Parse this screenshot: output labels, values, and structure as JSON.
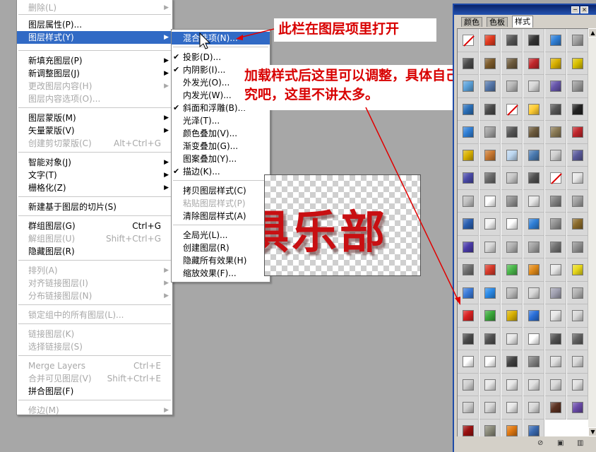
{
  "main_menu": {
    "items": [
      {
        "label": "删除(L)",
        "shortcut": "",
        "submenu": true,
        "disabled": true
      },
      {
        "label": "图层属性(P)...",
        "shortcut": "",
        "submenu": false,
        "disabled": false
      },
      {
        "label": "图层样式(Y)",
        "shortcut": "",
        "submenu": true,
        "disabled": false,
        "highlighted": true
      },
      {
        "label": "新填充图层(P)",
        "shortcut": "",
        "submenu": true,
        "disabled": false
      },
      {
        "label": "新调整图层(J)",
        "shortcut": "",
        "submenu": true,
        "disabled": false
      },
      {
        "label": "更改图层内容(H)",
        "shortcut": "",
        "submenu": true,
        "disabled": true
      },
      {
        "label": "图层内容选项(O)...",
        "shortcut": "",
        "submenu": false,
        "disabled": true
      },
      {
        "label": "图层蒙版(M)",
        "shortcut": "",
        "submenu": true,
        "disabled": false
      },
      {
        "label": "矢量蒙版(V)",
        "shortcut": "",
        "submenu": true,
        "disabled": false
      },
      {
        "label": "创建剪切蒙版(C)",
        "shortcut": "Alt+Ctrl+G",
        "submenu": false,
        "disabled": true
      },
      {
        "label": "智能对象(J)",
        "shortcut": "",
        "submenu": true,
        "disabled": false
      },
      {
        "label": "文字(T)",
        "shortcut": "",
        "submenu": true,
        "disabled": false
      },
      {
        "label": "栅格化(Z)",
        "shortcut": "",
        "submenu": true,
        "disabled": false
      },
      {
        "label": "新建基于图层的切片(S)",
        "shortcut": "",
        "submenu": false,
        "disabled": false
      },
      {
        "label": "群组图层(G)",
        "shortcut": "Ctrl+G",
        "submenu": false,
        "disabled": false
      },
      {
        "label": "解组图层(U)",
        "shortcut": "Shift+Ctrl+G",
        "submenu": false,
        "disabled": true
      },
      {
        "label": "隐藏图层(R)",
        "shortcut": "",
        "submenu": false,
        "disabled": false
      },
      {
        "label": "排列(A)",
        "shortcut": "",
        "submenu": true,
        "disabled": true
      },
      {
        "label": "对齐链接图层(I)",
        "shortcut": "",
        "submenu": true,
        "disabled": true
      },
      {
        "label": "分布链接图层(N)",
        "shortcut": "",
        "submenu": true,
        "disabled": true
      },
      {
        "label": "锁定组中的所有图层(L)...",
        "shortcut": "",
        "submenu": false,
        "disabled": true
      },
      {
        "label": "链接图层(K)",
        "shortcut": "",
        "submenu": false,
        "disabled": true
      },
      {
        "label": "选择链接层(S)",
        "shortcut": "",
        "submenu": false,
        "disabled": true
      },
      {
        "label": "Merge Layers",
        "shortcut": "Ctrl+E",
        "submenu": false,
        "disabled": true
      },
      {
        "label": "合并可见图层(V)",
        "shortcut": "Shift+Ctrl+E",
        "submenu": false,
        "disabled": true
      },
      {
        "label": "拼合图层(F)",
        "shortcut": "",
        "submenu": false,
        "disabled": false
      },
      {
        "label": "修边(M)",
        "shortcut": "",
        "submenu": true,
        "disabled": true
      }
    ]
  },
  "sub_menu": {
    "items": [
      {
        "label": "混合选项(N)...",
        "checked": false,
        "disabled": false,
        "highlighted": true
      },
      {
        "label": "投影(D)...",
        "checked": true,
        "disabled": false
      },
      {
        "label": "内阴影(I)...",
        "checked": true,
        "disabled": false
      },
      {
        "label": "外发光(O)...",
        "checked": false,
        "disabled": false
      },
      {
        "label": "内发光(W)...",
        "checked": false,
        "disabled": false
      },
      {
        "label": "斜面和浮雕(B)...",
        "checked": true,
        "disabled": false
      },
      {
        "label": "光泽(T)...",
        "checked": false,
        "disabled": false
      },
      {
        "label": "颜色叠加(V)...",
        "checked": false,
        "disabled": false
      },
      {
        "label": "渐变叠加(G)...",
        "checked": false,
        "disabled": false
      },
      {
        "label": "图案叠加(Y)...",
        "checked": false,
        "disabled": false
      },
      {
        "label": "描边(K)...",
        "checked": true,
        "disabled": false
      },
      {
        "label": "拷贝图层样式(C)",
        "checked": false,
        "disabled": false
      },
      {
        "label": "粘贴图层样式(P)",
        "checked": false,
        "disabled": true
      },
      {
        "label": "清除图层样式(A)",
        "checked": false,
        "disabled": false
      },
      {
        "label": "全局光(L)...",
        "checked": false,
        "disabled": false
      },
      {
        "label": "创建图层(R)",
        "checked": false,
        "disabled": false
      },
      {
        "label": "隐藏所有效果(H)",
        "checked": false,
        "disabled": false
      },
      {
        "label": "缩放效果(F)...",
        "checked": false,
        "disabled": false
      }
    ]
  },
  "canvas": {
    "text": "俱乐部"
  },
  "callouts": {
    "top": "此栏在图层项里打开",
    "body": "加载样式后这里可以调整，具体自己研究吧，这里不讲太多。"
  },
  "palette": {
    "tabs": [
      "颜色",
      "色板",
      "样式"
    ],
    "active_tab": "样式",
    "title_buttons": [
      "−",
      "×"
    ],
    "swatches": [
      [
        "none",
        "#e23a1f",
        "#555555",
        "#333333",
        "#2f7fd6",
        "#a0a0a0"
      ],
      [
        "#4a4a4a",
        "#7b5a2a",
        "#6d5b3d",
        "#c0262b",
        "#d8b000",
        "#d8c000"
      ],
      [
        "#5aa0d8",
        "#5577aa",
        "#b8b8b8",
        "#d8d8d8",
        "#6655aa",
        "#999999"
      ],
      [
        "#2a6fb8",
        "#4a4a4a",
        "none",
        "#ffcc33",
        "#555555",
        "#222222"
      ],
      [
        "#2f7fd6",
        "#a0a0a0",
        "#555555",
        "#6d5b3d",
        "#8a7a55",
        "#c0262b"
      ],
      [
        "#d8b000",
        "#c87830",
        "#bcd6f0",
        "#4a7ab0",
        "#cfcfcf",
        "#5a5a9a"
      ],
      [
        "#4a4aa8",
        "#6a6a6a",
        "#c8c8c8",
        "#505050",
        "none",
        "#e8e8e8"
      ],
      [
        "#c0c0c0",
        "#ffffff",
        "#909090",
        "#e8e8e8",
        "#808080",
        "#a0a0a0"
      ],
      [
        "#2a5fb0",
        "#f4f4f4",
        "#ffffff",
        "#2f7fd6",
        "#909090",
        "#8a6a2a"
      ],
      [
        "#4a3aa8",
        "#d8d8d8",
        "#b0b0b0",
        "#a0a0a0",
        "#707070",
        "#909090"
      ],
      [
        "#707070",
        "#d83a2a",
        "#4ab84a",
        "#e08a1a",
        "#e8e8e8",
        "#e8d81a"
      ],
      [
        "#3a7ad8",
        "#2a8ae8",
        "#bcbcbc",
        "#d8d8d8",
        "#a0a0b0",
        "#b0b0b0"
      ],
      [
        "#d82020",
        "#3aa83a",
        "#d8b000",
        "#2a6fd8",
        "#e8e8e8",
        "#d8d8d8"
      ],
      [
        "#4a4a4a",
        "#505050",
        "#e8e8e8",
        "#ffffff",
        "#505050",
        "#606060"
      ],
      [
        "#ffffff",
        "#ffffff",
        "#404040",
        "#808080",
        "#e0e0e0",
        "#d8d8d8"
      ],
      [
        "#cfcfcf",
        "#e8e8e8",
        "#e8e8e8",
        "#e0e0e0",
        "#d8d8d8",
        "#e0e0e0"
      ],
      [
        "#cfcfcf",
        "#d8d8d8",
        "#e8e8e8",
        "#d8d8d8",
        "#5a3020",
        "#6a4aa8"
      ],
      [
        "#9a1010",
        "#8a8a7a",
        "#e07810",
        "#3a6ab0",
        "",
        ""
      ]
    ]
  }
}
